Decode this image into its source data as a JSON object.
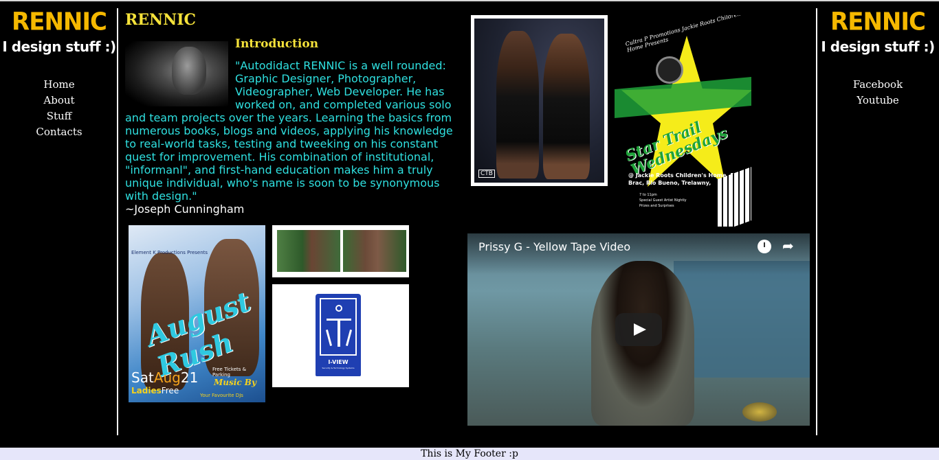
{
  "left_sidebar": {
    "brand": "RENNIC",
    "tagline": "I design stuff :)",
    "nav": [
      "Home",
      "About",
      "Stuff",
      "Contacts"
    ]
  },
  "right_sidebar": {
    "brand": "RENNIC",
    "tagline": "I design stuff :)",
    "links": [
      "Facebook",
      "Youtube"
    ]
  },
  "main": {
    "title": "RENNIC",
    "intro_heading": "Introduction",
    "quote": "\"Autodidact RENNIC is a well rounded: Graphic Designer, Photographer, Videographer, Web Developer. He has worked on, and completed various solo and team projects over the years. Learning the basics from numerous books, blogs and videos, applying his knowledge to real-world tasks, testing and tweeking on his constant quest for improvement. His combination of institutional, \"informanl\", and first-hand education makes him a truly unique individual, who's name is soon to be synonymous with design.\"",
    "author": "~Joseph Cunningham"
  },
  "flyer": {
    "brandline": "Element K Productions Presents",
    "script": "August Rush",
    "date_prefix": "Sat",
    "date_month": "Aug",
    "date_day": "21",
    "ladies_a": "Ladies",
    "ladies_b": "Free",
    "free_line": "Free Tickets & Parking",
    "music": "Music By",
    "djs": "Your Favourite DJs"
  },
  "logo": {
    "label": "I-VIEW",
    "sub": "Security & Technology Systems"
  },
  "photo": {
    "watermark": "CTB"
  },
  "poster": {
    "top": "Cultra P Promotions Jackie Roots Children's Home Presents",
    "title": "Star Trail Wednesdays",
    "location": "@ Jackie Roots Children's Home, Rio Brac, Rio Bueno, Trelawny,",
    "small1": "7 to 11pm",
    "small2": "Special Guest Artist Nightly",
    "small3": "Prizes and Surprises"
  },
  "video": {
    "title": "Prissy G - Yellow Tape Video"
  },
  "footer": {
    "text": "This is My Footer :p"
  }
}
